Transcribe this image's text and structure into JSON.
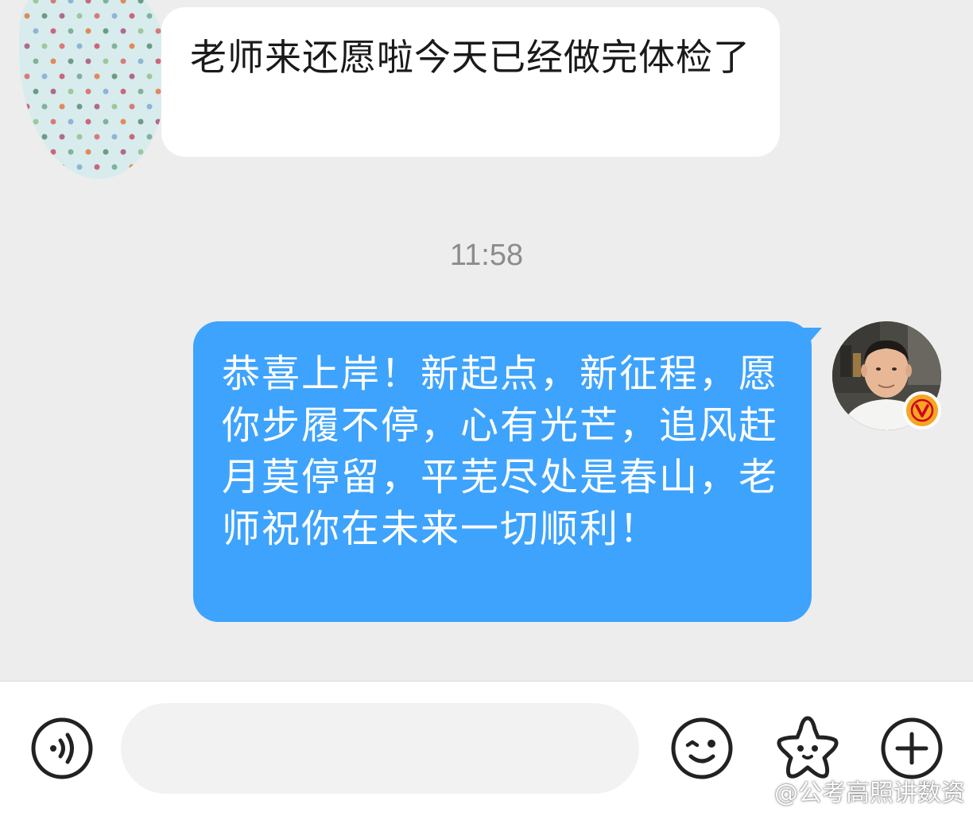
{
  "messages": {
    "incoming": {
      "text": "老师来还愿啦今天已经做完体检了"
    },
    "timestamp": "11:58",
    "outgoing": {
      "text": "恭喜上岸！新起点，新征程，愿你步履不停，心有光芒，追风赶月莫停留，平芜尽处是春山，老师祝你在未来一切顺利！"
    }
  },
  "input_bar": {
    "input_value": "",
    "input_placeholder": "",
    "icons": {
      "voice": "voice-icon",
      "emoji": "emoji-icon",
      "sticker": "sticker-icon",
      "more": "plus-icon"
    }
  },
  "watermark": {
    "text": "@公考高照讲数资"
  },
  "colors": {
    "background": "#ededed",
    "outgoing_bubble": "#3ea3fd",
    "incoming_bubble": "#ffffff",
    "timestamp": "#8c8c8c",
    "verified_badge": "#f5a623"
  }
}
